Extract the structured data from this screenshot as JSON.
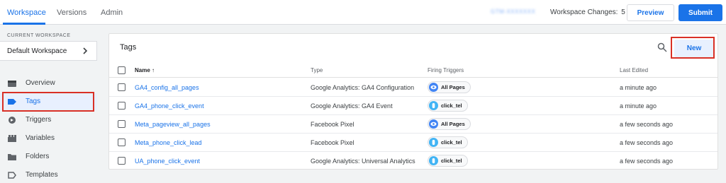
{
  "topbar": {
    "tabs": [
      {
        "label": "Workspace",
        "active": true
      },
      {
        "label": "Versions",
        "active": false
      },
      {
        "label": "Admin",
        "active": false
      }
    ],
    "container_id": "GTM-XXXXXXX",
    "changes_label": "Workspace Changes:",
    "changes_count": "5",
    "preview_label": "Preview",
    "submit_label": "Submit"
  },
  "sidebar": {
    "current_workspace_label": "CURRENT WORKSPACE",
    "workspace_name": "Default Workspace",
    "items": [
      {
        "label": "Overview",
        "icon": "overview-icon"
      },
      {
        "label": "Tags",
        "icon": "tag-icon",
        "active": true
      },
      {
        "label": "Triggers",
        "icon": "trigger-icon"
      },
      {
        "label": "Variables",
        "icon": "variables-icon"
      },
      {
        "label": "Folders",
        "icon": "folder-icon"
      },
      {
        "label": "Templates",
        "icon": "template-icon"
      }
    ]
  },
  "main": {
    "title": "Tags",
    "new_label": "New",
    "columns": {
      "name": "Name",
      "type": "Type",
      "triggers": "Firing Triggers",
      "edited": "Last Edited"
    },
    "rows": [
      {
        "name": "GA4_config_all_pages",
        "type": "Google Analytics: GA4 Configuration",
        "trigger": "All Pages",
        "trigger_icon": "eye-icon",
        "edited": "a minute ago"
      },
      {
        "name": "GA4_phone_click_event",
        "type": "Google Analytics: GA4 Event",
        "trigger": "click_tel",
        "trigger_icon": "click-icon",
        "edited": "a minute ago"
      },
      {
        "name": "Meta_pageview_all_pages",
        "type": "Facebook Pixel",
        "trigger": "All Pages",
        "trigger_icon": "eye-icon",
        "edited": "a few seconds ago"
      },
      {
        "name": "Meta_phone_click_lead",
        "type": "Facebook Pixel",
        "trigger": "click_tel",
        "trigger_icon": "click-icon",
        "edited": "a few seconds ago"
      },
      {
        "name": "UA_phone_click_event",
        "type": "Google Analytics: Universal Analytics",
        "trigger": "click_tel",
        "trigger_icon": "click-icon",
        "edited": "a few seconds ago"
      }
    ]
  },
  "colors": {
    "accent": "#1a73e8",
    "highlight_box": "#d93025",
    "active_bg": "#e8f0fe"
  }
}
